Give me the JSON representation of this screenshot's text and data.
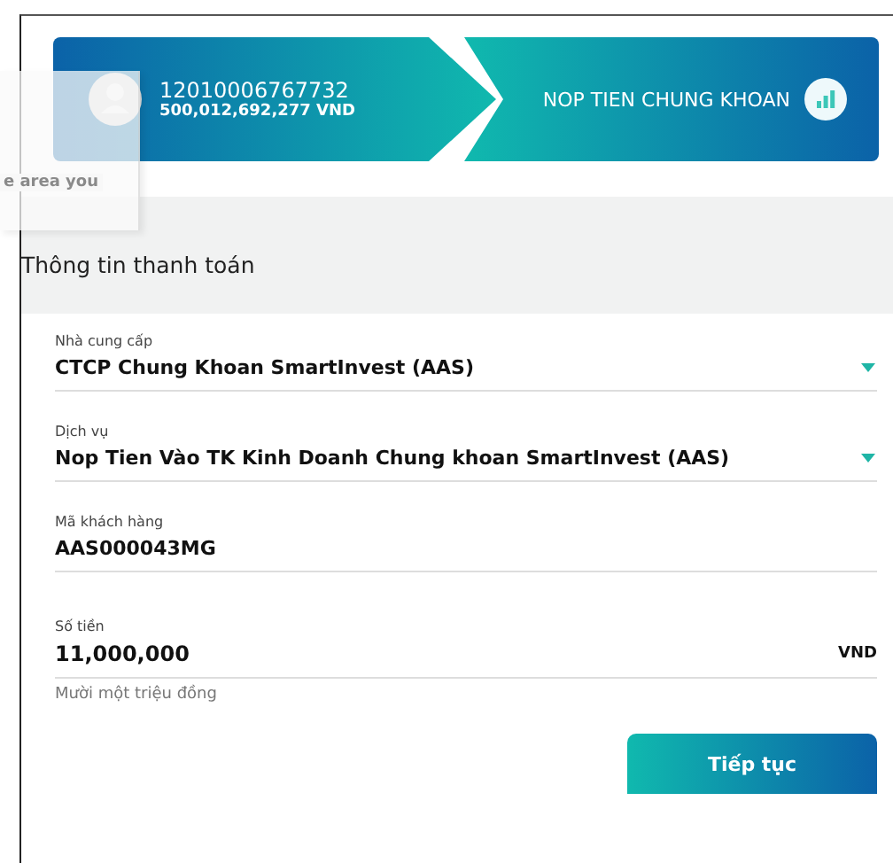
{
  "account": {
    "number": "12010006767732",
    "balance": "500,012,692,277 VND"
  },
  "service_banner": {
    "title": "NOP TIEN CHUNG KHOAN"
  },
  "ghost_popup": {
    "text": "e area you"
  },
  "section_title": "Thông tin thanh toán",
  "fields": [
    {
      "kind": "select",
      "label": "Nhà cung cấp",
      "value": "CTCP Chung Khoan SmartInvest (AAS)"
    },
    {
      "kind": "select",
      "label": "Dịch vụ",
      "value": "Nop Tien Vào TK Kinh Doanh Chung khoan SmartInvest (AAS)"
    },
    {
      "kind": "text",
      "label": "Mã khách hàng",
      "value": "AAS000043MG"
    },
    {
      "kind": "amount",
      "label": "Số tiền",
      "value": "11,000,000",
      "unit": "VND",
      "hint": "Mười một triệu đồng"
    }
  ],
  "continue_button": "Tiếp tục"
}
